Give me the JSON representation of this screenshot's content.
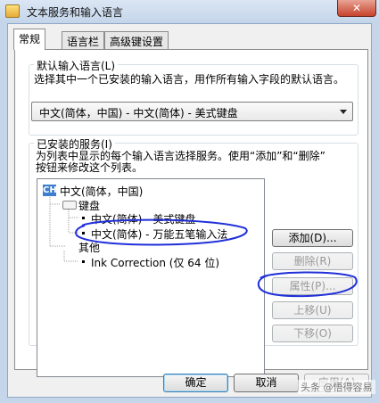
{
  "window": {
    "title": "文本服务和输入语言",
    "close_label": "✕"
  },
  "tabs": [
    {
      "label": "常规",
      "active": true
    },
    {
      "label": "语言栏",
      "active": false
    },
    {
      "label": "高级键设置",
      "active": false
    }
  ],
  "default_language": {
    "group_label": "默认输入语言(L)",
    "description": "选择其中一个已安装的输入语言，用作所有输入字段的默认语言。",
    "selected": "中文(简体，中国) - 中文(简体) - 美式键盘"
  },
  "installed_services": {
    "group_label": "已安装的服务(I)",
    "description_line1": "为列表中显示的每个输入语言选择服务。使用“添加”和“删除”",
    "description_line2": "按钮来修改这个列表。",
    "tree": {
      "language_icon": "CH",
      "language": "中文(简体，中国)",
      "keyboard_category": "键盘",
      "keyboard_items": [
        "中文(简体) - 美式键盘",
        "中文(简体) - 万能五笔输入法"
      ],
      "other_category": "其他",
      "other_items": [
        "Ink Correction (仅 64 位)"
      ]
    },
    "buttons": {
      "add": "添加(D)...",
      "remove": "删除(R)",
      "properties": "属性(P)...",
      "move_up": "上移(U)",
      "move_down": "下移(O)"
    }
  },
  "footer": {
    "ok": "确定",
    "cancel": "取消",
    "apply": "应用(A)"
  },
  "watermark": "头条 @悟得容易",
  "annotation_color": "#1f2fd8"
}
